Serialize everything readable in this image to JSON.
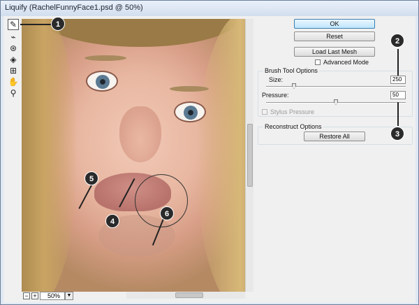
{
  "window": {
    "title": "Liquify (RachelFunnyFace1.psd @ 50%)"
  },
  "tools": [
    {
      "name": "forward-warp-tool",
      "glyph": "✎",
      "selected": true
    },
    {
      "name": "reconstruct-tool",
      "glyph": "⌁",
      "selected": false
    },
    {
      "name": "pucker-tool",
      "glyph": "⊛",
      "selected": false
    },
    {
      "name": "bloat-tool",
      "glyph": "◈",
      "selected": false
    },
    {
      "name": "push-left-tool",
      "glyph": "⊞",
      "selected": false
    },
    {
      "name": "hand-tool",
      "glyph": "✋",
      "selected": false
    },
    {
      "name": "zoom-tool",
      "glyph": "⚲",
      "selected": false
    }
  ],
  "callouts": [
    "1",
    "2",
    "3",
    "4",
    "5",
    "6"
  ],
  "status": {
    "zoom": "50%",
    "zoom_out": "−",
    "zoom_in": "+",
    "dropdown": "▼"
  },
  "panel": {
    "ok": "OK",
    "reset": "Reset",
    "load_last_mesh": "Load Last Mesh",
    "advanced_mode": "Advanced Mode",
    "brush_group_title": "Brush Tool Options",
    "size_label": "Size:",
    "size_value": "250",
    "size_level": 0.2,
    "pressure_label": "Pressure:",
    "pressure_value": "50",
    "pressure_level": 0.5,
    "stylus_pressure": "Stylus Pressure",
    "reconstruct_group_title": "Reconstruct Options",
    "restore_all": "Restore All"
  },
  "colors": {
    "callout": "#2a2a2a",
    "default_button": "#bee6fd",
    "frame": "#dfe8f4"
  }
}
